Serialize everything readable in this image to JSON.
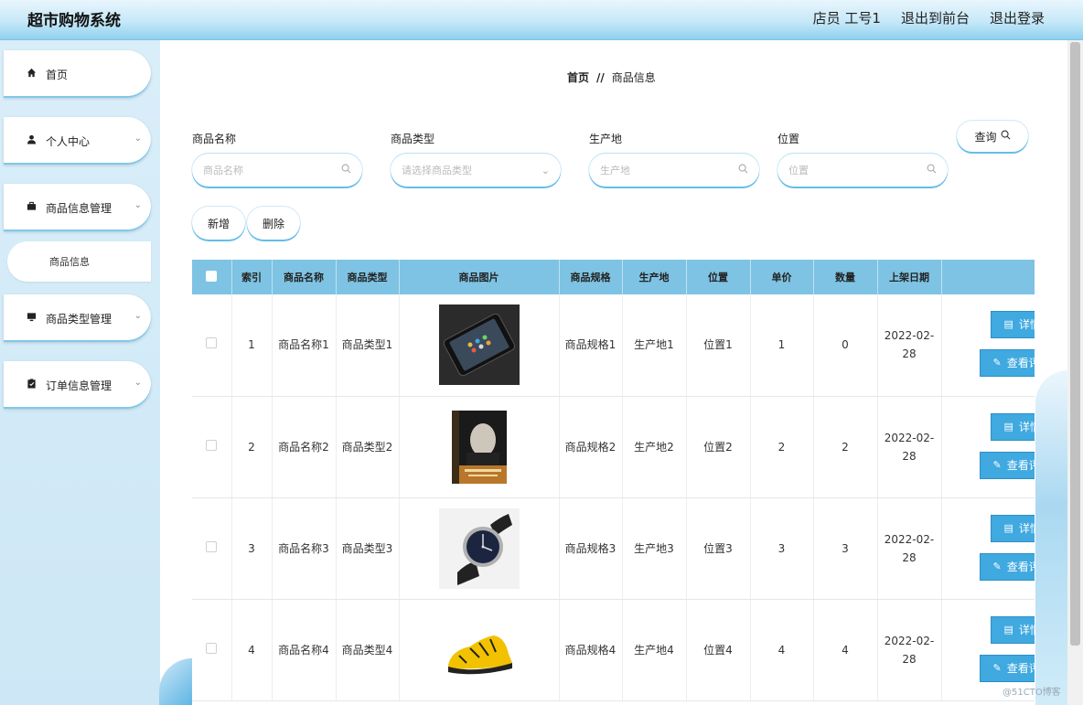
{
  "header": {
    "title": "超市购物系统",
    "user_label": "店员 工号1",
    "back_to_front": "退出到前台",
    "logout": "退出登录"
  },
  "sidebar": {
    "items": [
      {
        "label": "首页",
        "icon": "home-icon"
      },
      {
        "label": "个人中心",
        "icon": "user-icon"
      },
      {
        "label": "商品信息管理",
        "icon": "briefcase-icon"
      },
      {
        "label": "商品信息",
        "icon": ""
      },
      {
        "label": "商品类型管理",
        "icon": "monitor-icon"
      },
      {
        "label": "订单信息管理",
        "icon": "clipboard-icon"
      }
    ]
  },
  "breadcrumb": {
    "home": "首页",
    "separator": "//",
    "current": "商品信息"
  },
  "filters": {
    "name": {
      "label": "商品名称",
      "placeholder": "商品名称"
    },
    "type": {
      "label": "商品类型",
      "placeholder": "请选择商品类型"
    },
    "origin": {
      "label": "生产地",
      "placeholder": "生产地"
    },
    "position": {
      "label": "位置",
      "placeholder": "位置"
    },
    "query_label": "查询"
  },
  "actions": {
    "add_label": "新增",
    "delete_label": "删除"
  },
  "table": {
    "columns": [
      "索引",
      "商品名称",
      "商品类型",
      "商品图片",
      "商品规格",
      "生产地",
      "位置",
      "单价",
      "数量",
      "上架日期"
    ],
    "detail_label": "详情",
    "view_label": "查看评论",
    "rows": [
      {
        "index": "1",
        "name": "商品名称1",
        "type": "商品类型1",
        "image": "smartphone",
        "spec": "商品规格1",
        "origin": "生产地1",
        "position": "位置1",
        "price": "1",
        "qty": "0",
        "date": "2022-02-28"
      },
      {
        "index": "2",
        "name": "商品名称2",
        "type": "商品类型2",
        "image": "book",
        "spec": "商品规格2",
        "origin": "生产地2",
        "position": "位置2",
        "price": "2",
        "qty": "2",
        "date": "2022-02-28"
      },
      {
        "index": "3",
        "name": "商品名称3",
        "type": "商品类型3",
        "image": "watch",
        "spec": "商品规格3",
        "origin": "生产地3",
        "position": "位置3",
        "price": "3",
        "qty": "3",
        "date": "2022-02-28"
      },
      {
        "index": "4",
        "name": "商品名称4",
        "type": "商品类型4",
        "image": "sneaker",
        "spec": "商品规格4",
        "origin": "生产地4",
        "position": "位置4",
        "price": "4",
        "qty": "4",
        "date": "2022-02-28"
      }
    ]
  },
  "watermark": "@51CTO博客",
  "colors": {
    "accent": "#7ec3e3",
    "button": "#3fa9e0",
    "sidebar_bg": "#d9eef9"
  }
}
